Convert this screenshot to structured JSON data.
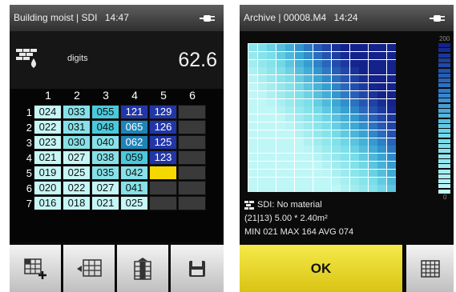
{
  "left_screen": {
    "title": "Building moist | SDI",
    "time": "14:47",
    "unit": "digits",
    "value": "62.6",
    "columns": [
      "1",
      "2",
      "3",
      "4",
      "5",
      "6"
    ],
    "rows": [
      {
        "label": "1",
        "cells": [
          "024",
          "033",
          "055",
          "121",
          "129",
          ""
        ]
      },
      {
        "label": "2",
        "cells": [
          "022",
          "031",
          "048",
          "065",
          "126",
          ""
        ]
      },
      {
        "label": "3",
        "cells": [
          "023",
          "030",
          "040",
          "062",
          "125",
          ""
        ]
      },
      {
        "label": "4",
        "cells": [
          "021",
          "027",
          "038",
          "059",
          "123",
          ""
        ]
      },
      {
        "label": "5",
        "cells": [
          "019",
          "025",
          "035",
          "042",
          "",
          ""
        ]
      },
      {
        "label": "6",
        "cells": [
          "020",
          "022",
          "027",
          "041",
          "",
          ""
        ]
      },
      {
        "label": "7",
        "cells": [
          "016",
          "018",
          "021",
          "025",
          "",
          ""
        ]
      }
    ],
    "cursor_cell": {
      "row": 5,
      "col": 5,
      "color": "#f5d800"
    },
    "toolbar": [
      "add-measurement-icon",
      "grid-transfer-icon",
      "export-column-icon",
      "save-icon"
    ]
  },
  "right_screen": {
    "title": "Archive | 00008.M4",
    "time": "14:24",
    "scale_max": "200",
    "scale_min": "0",
    "material_line": "SDI:  No material",
    "grid_line": "(21|13)    5.00 * 2.40m²",
    "stats_line": "MIN 021     MAX 164     AVG 074",
    "ok_label": "OK",
    "colors": {
      "low": "#b9f4f4",
      "mid": "#3fb7d8",
      "high": "#1b2e9a",
      "ok_button": "#f1e23a"
    }
  }
}
